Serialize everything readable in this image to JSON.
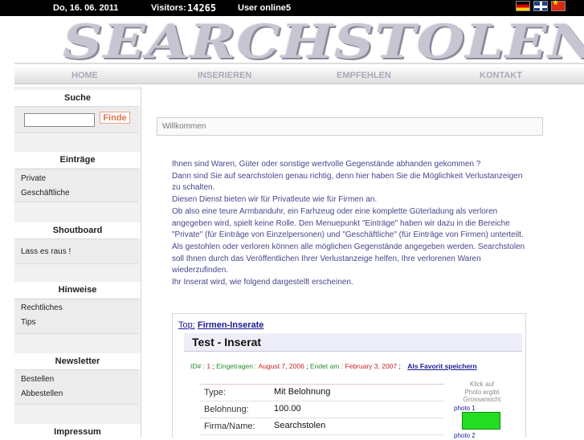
{
  "topbar": {
    "date": "Do, 16. 06. 2011",
    "visitors_label": "Visitors:",
    "visitors_count": "14265",
    "online_label": "User online:",
    "online_count": "5"
  },
  "languages": [
    "de",
    "en",
    "zh"
  ],
  "logo": {
    "text": "SEARCHSTOLEN"
  },
  "nav": {
    "home": "HOME",
    "inserieren": "INSERIEREN",
    "empfehlen": "EMPFEHLEN",
    "kontakt": "KONTAKT"
  },
  "sidebar": {
    "suche": {
      "title": "Suche",
      "input_value": "",
      "button": "Finde"
    },
    "eintraege": {
      "title": "Einträge",
      "items": [
        "Private",
        "Geschäftliche"
      ]
    },
    "shoutboard": {
      "title": "Shoutboard",
      "items": [
        "Lass es raus !"
      ]
    },
    "hinweise": {
      "title": "Hinweise",
      "items": [
        "Rechtliches",
        "Tips"
      ]
    },
    "newsletter": {
      "title": "Newsletter",
      "items": [
        "Bestellen",
        "Abbestellen"
      ]
    },
    "impressum": {
      "title": "Impressum"
    }
  },
  "welcome": {
    "title": "Willkommen"
  },
  "intro": [
    "Ihnen sind Waren, Güter oder sonstige wertvolle Gegenstände abhanden gekommen ?",
    "Dann sind Sie auf searchstolen genau richtig, denn hier haben Sie die Möglichkeit Verlustanzeigen zu schalten.",
    "Diesen Dienst bieten wir für Privatleute wie für Firmen an.",
    "Ob also eine teure Armbanduhr, ein Farhzeug oder eine komplette Güterladung als verloren angegeben wird, spielt keine Rolle. Den Menuepunkt \"Einträge\" haben wir dazu in die Bereiche \"Private\" (für Einträge von Einzelpersonen) und \"Geschäftliche\" (für Einträge von Firmen) unterteilt.",
    "Als gestohlen oder verloren können alle möglichen Gegenstände angegeben werden. Searchstolen soll Ihnen durch das Veröffentlichen Ihrer Verlustanzeige helfen, Ihre verlorenen Waren wiederzufinden.",
    "Ihr Inserat wird, wie folgend dargestellt erscheinen."
  ],
  "example": {
    "breadcrumb_top": "Top:",
    "breadcrumb_category": "Firmen-Inserate",
    "title": "Test - Inserat",
    "id_label": "ID# :",
    "id_value": "1",
    "created_label": "Eingetragen :",
    "created_value": "August 7, 2006",
    "ends_label": "Endet am :",
    "ends_value": "February 3, 2007",
    "favorite": "Als Favorit speichern",
    "rows": [
      {
        "key": "Type:",
        "value": "Mit Belohnung"
      },
      {
        "key": "Belohnung:",
        "value": "100.00"
      },
      {
        "key": "Firma/Name:",
        "value": "Searchstolen"
      }
    ],
    "photo_hint": [
      "Klick auf",
      "Photo ergibt",
      "Grossansicht"
    ],
    "photo1": "photo 1",
    "photo2": "photo 2"
  }
}
